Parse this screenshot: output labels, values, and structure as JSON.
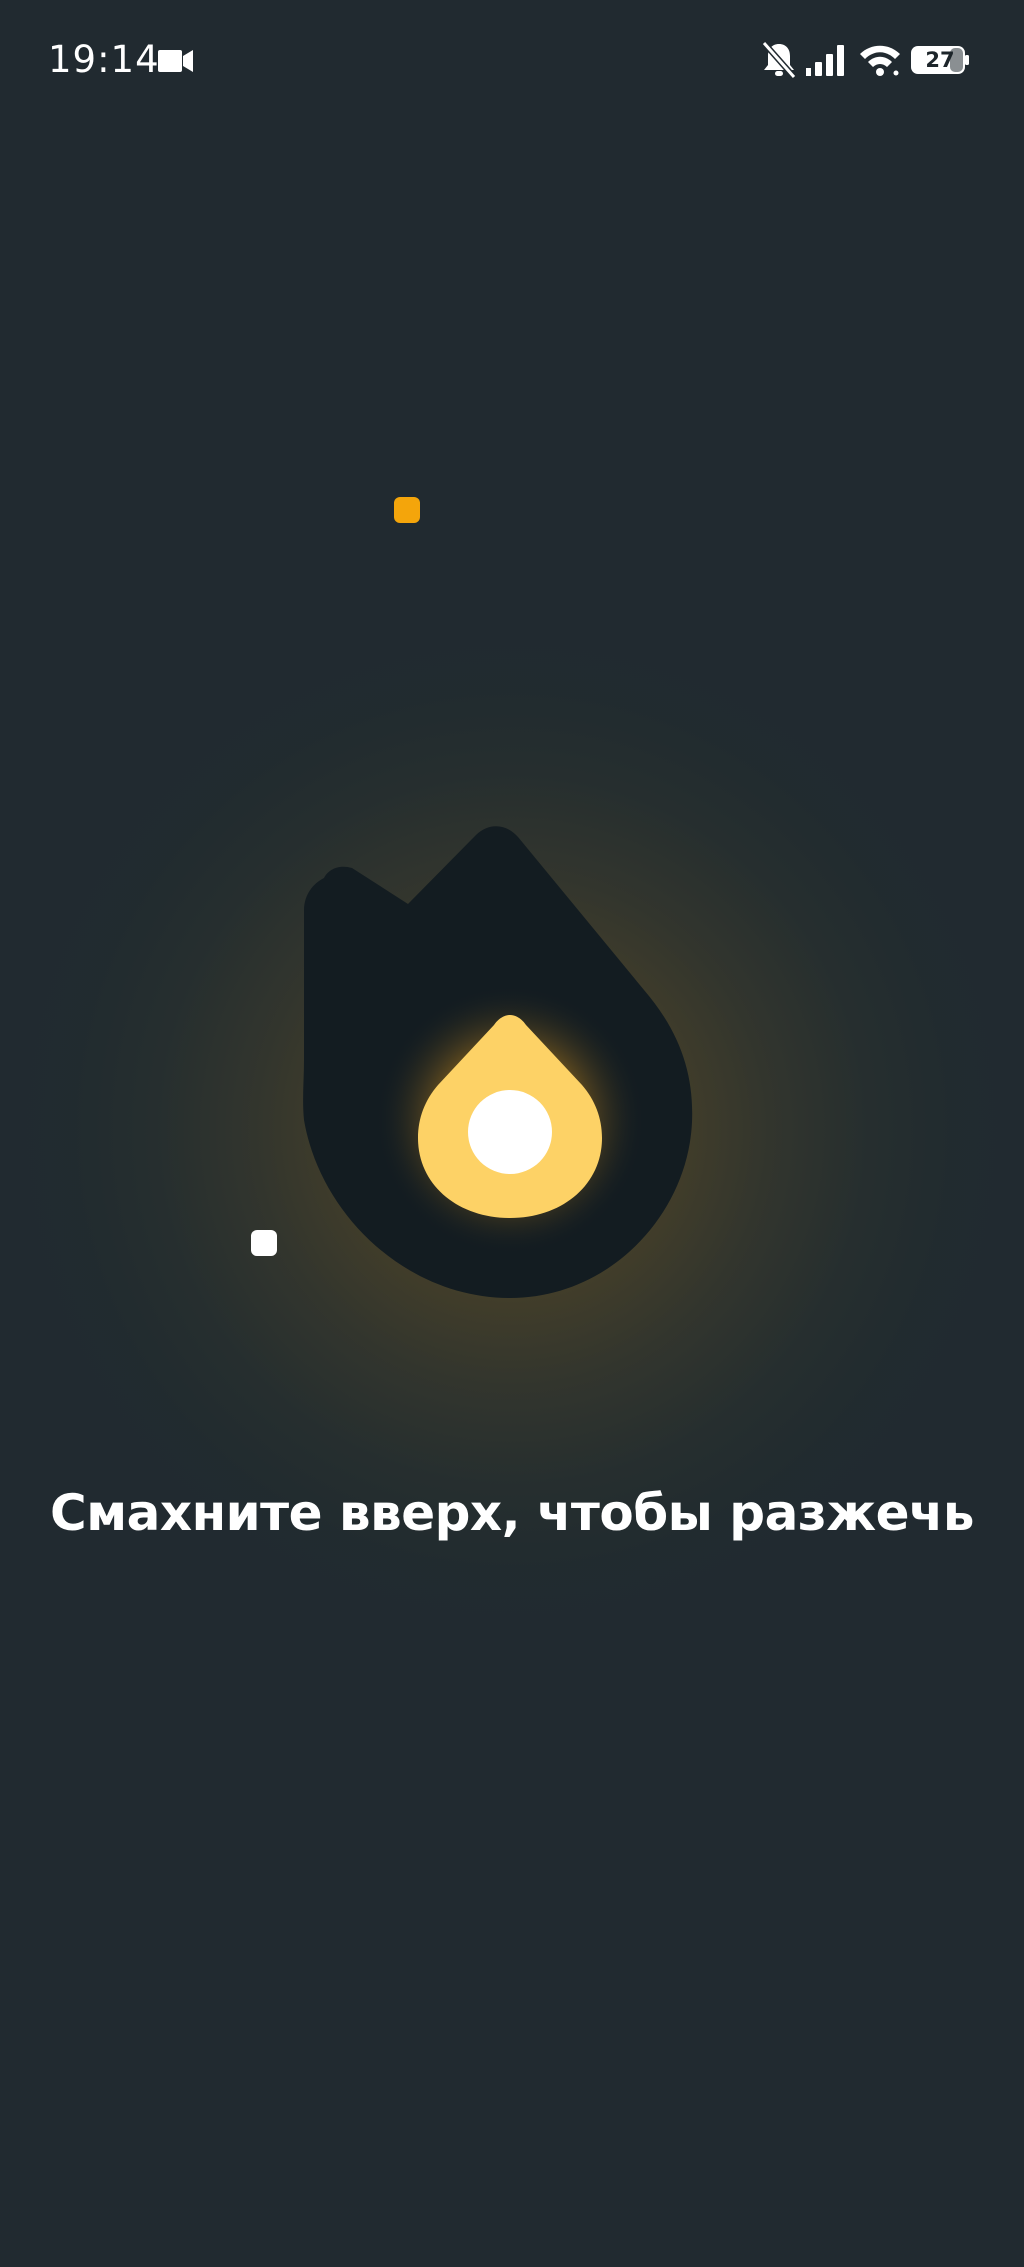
{
  "status_bar": {
    "time": "19:14",
    "battery_level": "27",
    "icons": [
      "video-camera-icon",
      "bell-off-icon",
      "signal-icon",
      "wifi-icon",
      "battery-icon"
    ]
  },
  "main": {
    "hint_text": "Смахните вверх, чтобы разжечь",
    "graphic": "flame-icon"
  },
  "colors": {
    "background": "#212a30",
    "flame_dark": "#131c21",
    "flame_yellow": "#fdd266",
    "particle_orange": "#f4a50b",
    "particle_white": "#ffffff"
  }
}
